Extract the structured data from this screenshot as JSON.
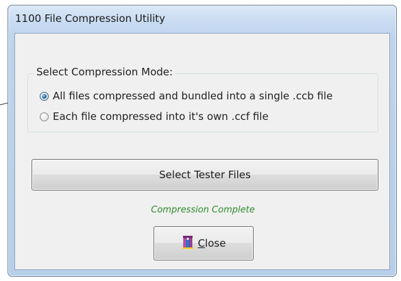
{
  "window": {
    "title": "1100 File Compression Utility"
  },
  "compression_mode": {
    "label": "Select Compression Mode:",
    "options": [
      {
        "label": "All files compressed and bundled into a single .ccb file",
        "selected": true
      },
      {
        "label": "Each file compressed into it's own .ccf file",
        "selected": false
      }
    ]
  },
  "select_files_button": {
    "label": "Select Tester Files"
  },
  "status": {
    "text": "Compression Complete",
    "color": "#2e8b2e"
  },
  "close_button": {
    "mnemonic": "C",
    "rest": "lose",
    "icon": "door-exit-icon"
  },
  "colors": {
    "window_frame": "#bfd4ee",
    "client_bg": "#f0f0f0",
    "radio_selected": "#1d5f9c"
  }
}
